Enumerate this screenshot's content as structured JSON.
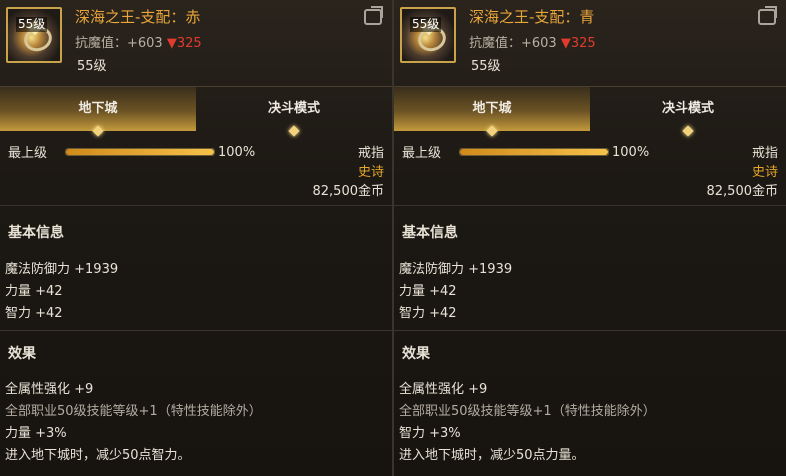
{
  "panels": [
    {
      "level_badge": "55级",
      "name": "深海之王-支配：赤",
      "resist_prefix": "抗魔值：+603 ",
      "resist_down": "▼325",
      "level_text": "55级",
      "tabs": [
        "地下城",
        "决斗模式"
      ],
      "grade_label": "最上级",
      "grade_percent": "100%",
      "grade_fill": 1.0,
      "slot": "戒指",
      "rarity": "史诗",
      "price": "82,500金币",
      "basic_title": "基本信息",
      "basic_stats": [
        "魔法防御力 +1939",
        "力量 +42",
        "智力 +42"
      ],
      "effect_title": "效果",
      "effects": [
        "全属性强化 +9",
        "全部职业50级技能等级+1（特性技能除外）",
        "力量 +3%",
        "进入地下城时，减少50点智力。"
      ]
    },
    {
      "level_badge": "55级",
      "name": "深海之王-支配：青",
      "resist_prefix": "抗魔值：+603 ",
      "resist_down": "▼325",
      "level_text": "55级",
      "tabs": [
        "地下城",
        "决斗模式"
      ],
      "grade_label": "最上级",
      "grade_percent": "100%",
      "grade_fill": 1.0,
      "slot": "戒指",
      "rarity": "史诗",
      "price": "82,500金币",
      "basic_title": "基本信息",
      "basic_stats": [
        "魔法防御力 +1939",
        "力量 +42",
        "智力 +42"
      ],
      "effect_title": "效果",
      "effects": [
        "全属性强化 +9",
        "全部职业50级技能等级+1（特性技能除外）",
        "智力 +3%",
        "进入地下城时，减少50点力量。"
      ]
    }
  ],
  "colors": {
    "item_name": "#e9a53a",
    "rarity": "#e0a52a",
    "resist_down": "#e23b2e",
    "tab_active": "#c49a3c"
  },
  "icons": {
    "share": "share-icon",
    "item": "ring-item-icon"
  }
}
